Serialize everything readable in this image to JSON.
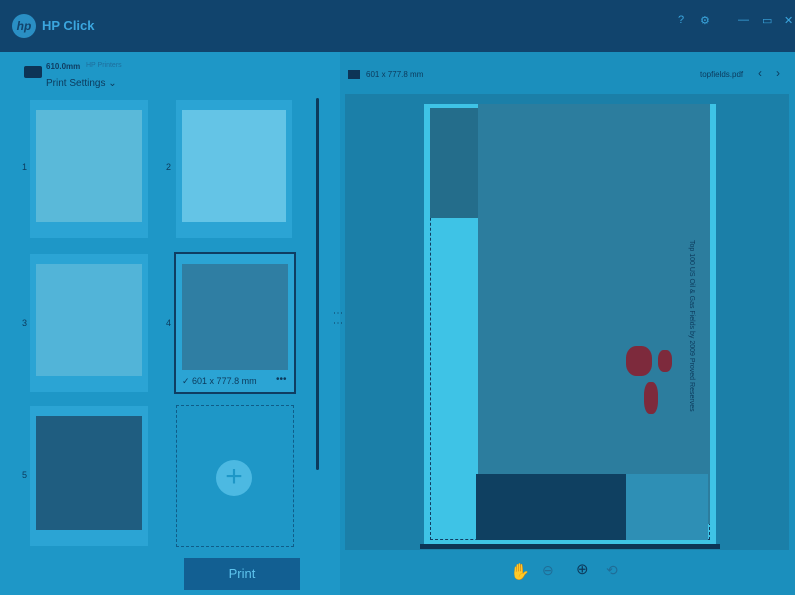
{
  "app": {
    "title": "HP Click",
    "logo_text": "hp"
  },
  "window_controls": {
    "help": "?",
    "settings": "⚙",
    "minimize": "—",
    "maximize": "▭",
    "close": "✕"
  },
  "printer": {
    "name": "610.0mm",
    "subtitle": "HP Printers",
    "settings_label": "Print Settings ⌄"
  },
  "thumbnails": [
    {
      "number": "1"
    },
    {
      "number": "2"
    },
    {
      "number": "3"
    },
    {
      "number": "4",
      "caption": "✓ 601 x 777.8 mm",
      "more": "•••"
    },
    {
      "number": "5"
    }
  ],
  "print_button": "Print",
  "preview": {
    "size_label": "601 x 777.8 mm",
    "file_name": "topfields.pdf",
    "prev": "‹",
    "next": "›",
    "map_title": "Top 100 US Oil & Gas Fields by 2009 Proved Reserves"
  },
  "tools": {
    "hand": "✋",
    "zoom_out": "⊖",
    "zoom_in": "⊕",
    "rotate": "⟲"
  },
  "colors": {
    "titlebar": "#11446d",
    "background": "#1b8fbd",
    "accent": "#3ba6de"
  }
}
